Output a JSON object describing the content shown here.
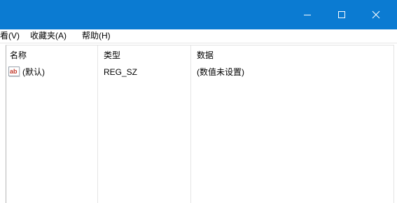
{
  "window": {
    "titlebar_color": "#0b7bd2",
    "controls": {
      "minimize": "minimize-icon",
      "maximize": "maximize-icon",
      "close": "close-icon"
    }
  },
  "menubar": {
    "items": [
      {
        "label": "看(V)"
      },
      {
        "label": "收藏夹(A)"
      },
      {
        "label": "帮助(H)"
      }
    ]
  },
  "table": {
    "columns": [
      {
        "label": "名称"
      },
      {
        "label": "类型"
      },
      {
        "label": "数据"
      }
    ],
    "rows": [
      {
        "icon": "string-value-icon",
        "name": "(默认)",
        "type": "REG_SZ",
        "data": "(数值未设置)"
      }
    ]
  }
}
